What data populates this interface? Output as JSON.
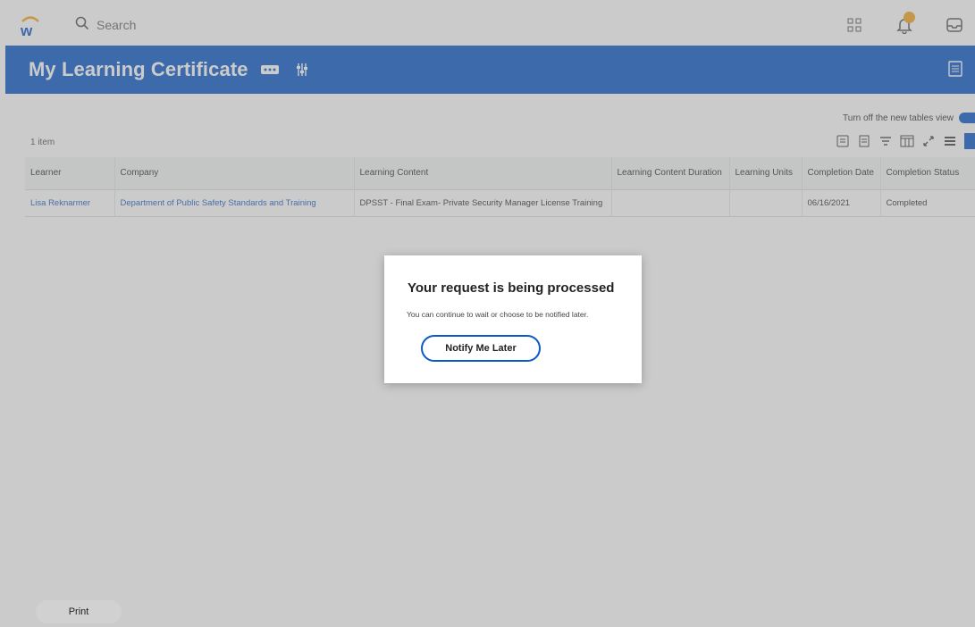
{
  "app": {
    "search": {
      "placeholder": "Search"
    },
    "colors": {
      "brand": "#0b58c7",
      "notification": "#f5a623",
      "link": "#1b5fc4"
    },
    "top_icons": [
      "apps-grid-icon",
      "notifications-bell-icon",
      "inbox-icon"
    ]
  },
  "header": {
    "title": "My Learning Certificate"
  },
  "content": {
    "toggle_label": "Turn off the new tables view",
    "items_label": "1 item",
    "table": {
      "columns": [
        "Learner",
        "Company",
        "Learning Content",
        "Learning Content Duration",
        "Learning Units",
        "Completion Date",
        "Completion Status"
      ],
      "rows": [
        [
          "Lisa Reknarmer",
          "Department of Public Safety Standards and Training",
          "DPSST - Final Exam- Private Security Manager License Training",
          "",
          "",
          "06/16/2021",
          "Completed"
        ]
      ]
    }
  },
  "footer": {
    "print_label": "Print"
  },
  "modal": {
    "title": "Your request is being processed",
    "message": "You can continue to wait or choose to be notified later.",
    "button_label": "Notify Me Later"
  }
}
